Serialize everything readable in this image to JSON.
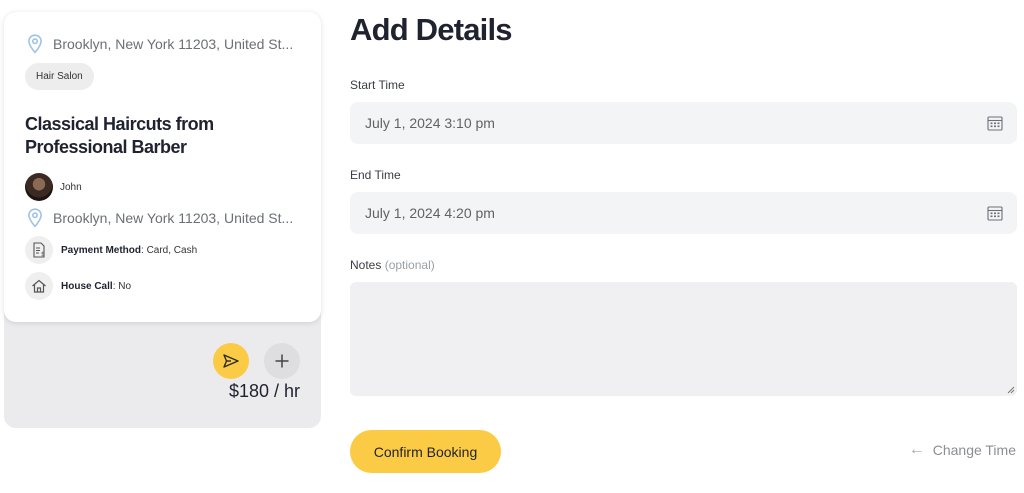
{
  "listing": {
    "location": "Brooklyn, New York 11203, United St...",
    "category": "Hair Salon",
    "title": "Classical Haircuts from Professional Barber",
    "author": "John",
    "location_secondary": "Brooklyn, New York 11203, United St...",
    "payment_label": "Payment Method",
    "payment_value": ": Card, Cash",
    "house_call_label": "House Call",
    "house_call_value": ": No",
    "price": "$180 / hr"
  },
  "form": {
    "title": "Add Details",
    "start_label": "Start Time",
    "start_value": "July 1, 2024 3:10 pm",
    "end_label": "End Time",
    "end_value": "July 1, 2024 4:20 pm",
    "notes_label": "Notes",
    "notes_optional": "(optional)",
    "notes_value": "",
    "confirm_label": "Confirm Booking",
    "change_time_label": "Change Time"
  },
  "colors": {
    "accent": "#fccb45",
    "pin": "#9ec3e6"
  },
  "icons": {
    "location": "location-pin-icon",
    "send": "send-icon",
    "add": "plus-icon",
    "calendar": "calendar-icon",
    "payment": "receipt-icon",
    "house": "house-icon",
    "back": "arrow-left-icon"
  }
}
